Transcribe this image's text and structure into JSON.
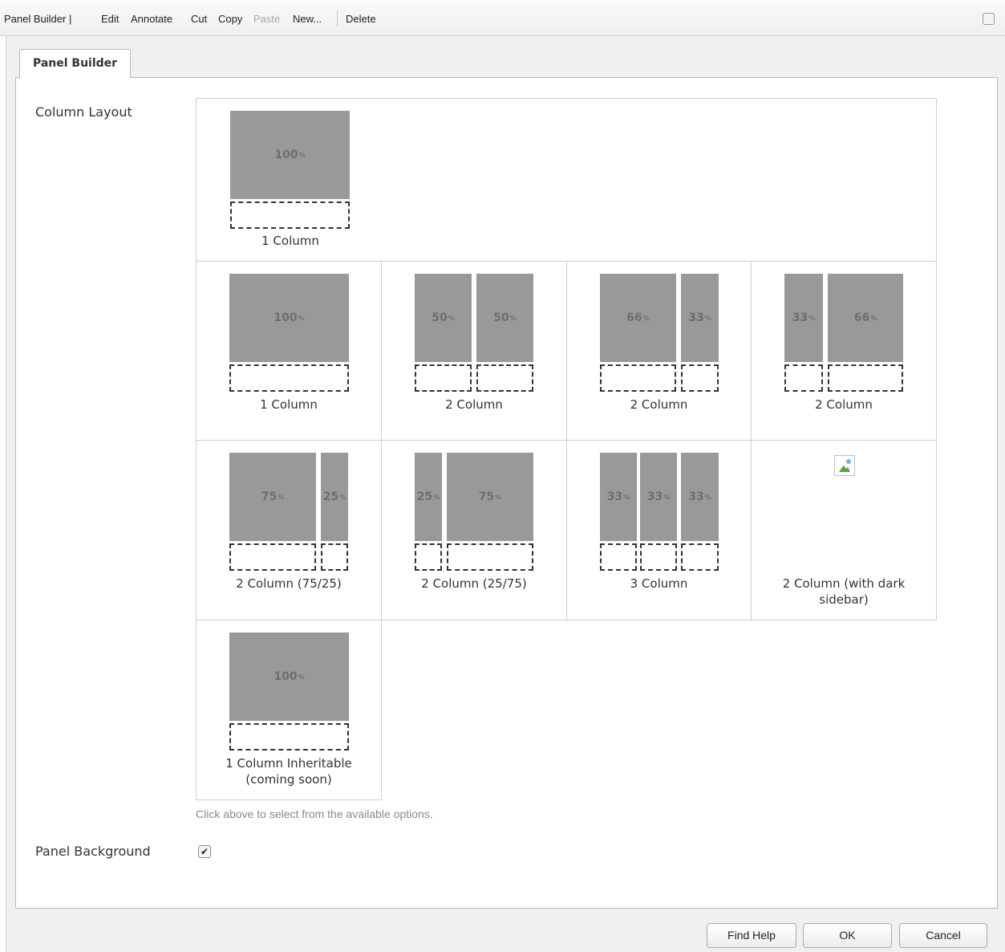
{
  "toolbar": {
    "items": [
      {
        "label": "Panel Builder |",
        "disabled": false
      },
      {
        "label": "Edit",
        "disabled": false
      },
      {
        "label": "Annotate",
        "disabled": false
      },
      {
        "label": "Cut",
        "disabled": false
      },
      {
        "label": "Copy",
        "disabled": false
      },
      {
        "label": "Paste",
        "disabled": true
      },
      {
        "label": "New...",
        "disabled": false
      },
      {
        "label": "Delete",
        "disabled": false
      }
    ]
  },
  "dialog": {
    "tab_label": "Panel Builder",
    "column_layout_label": "Column Layout",
    "panel_background_label": "Panel Background",
    "panel_background_checked": true,
    "checkbox_glyph": "✔",
    "hint": "Click above to select from the available options.",
    "layouts": [
      {
        "label": "1 Column",
        "cols": [
          100
        ]
      },
      {
        "label": "1 Column",
        "cols": [
          100
        ]
      },
      {
        "label": "2 Column",
        "cols": [
          50,
          50
        ]
      },
      {
        "label": "2 Column",
        "cols": [
          66,
          33
        ]
      },
      {
        "label": "2 Column",
        "cols": [
          33,
          66
        ]
      },
      {
        "label": "2 Column (75/25)",
        "cols": [
          75,
          25
        ]
      },
      {
        "label": "2 Column (25/75)",
        "cols": [
          25,
          75
        ]
      },
      {
        "label": "3 Column",
        "cols": [
          33,
          33,
          33
        ]
      },
      {
        "label": "2 Column (with dark sidebar)",
        "cols": [],
        "image_icon": "broken-image-icon"
      },
      {
        "label": "1 Column Inheritable (coming soon)",
        "cols": [
          100
        ]
      }
    ]
  },
  "buttons": {
    "find_help": "Find Help",
    "ok": "OK",
    "cancel": "Cancel"
  }
}
